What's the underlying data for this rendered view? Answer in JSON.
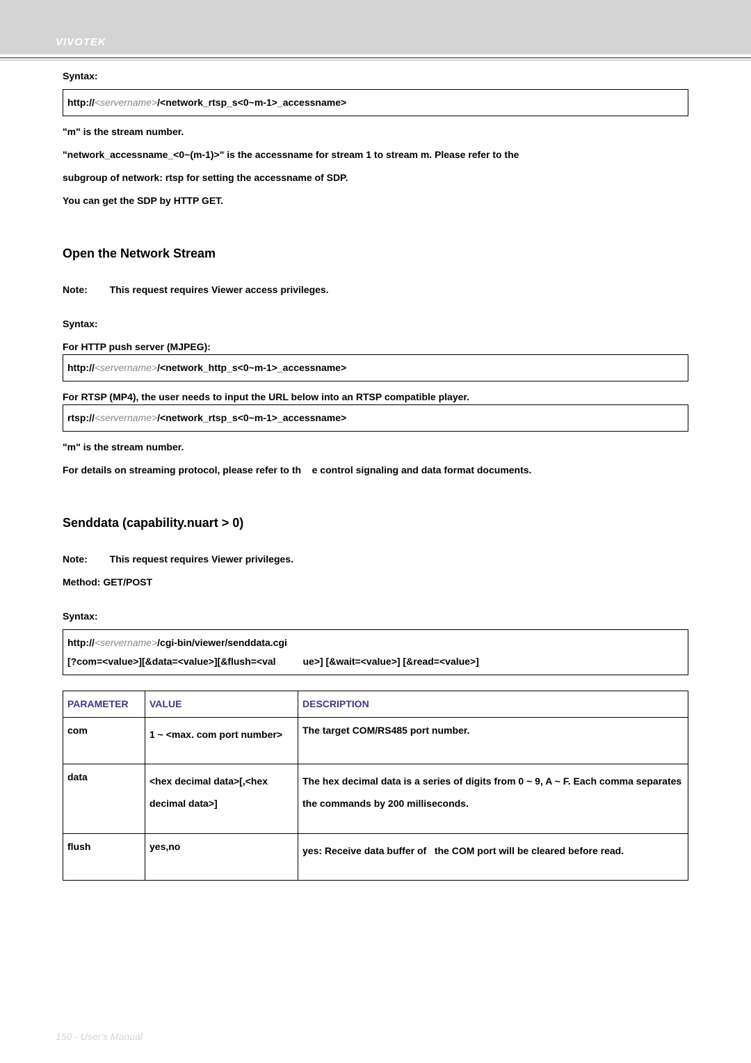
{
  "header": {
    "brand": "VIVOTEK"
  },
  "box1": {
    "syntax_label": "Syntax:",
    "line_prefix": "http://",
    "line_server_gray": "<servername>",
    "line_path_bold": "/<network_rtsp_s<0~m-1>_accessname>"
  },
  "paras1": {
    "p1": "\"m\" is the stream number.",
    "p2": "\"network_accessname_<0~(m-1)>\" is the accessname for stream 1 to stream m. Please refer to the",
    "p3": "subgroup of network: rtsp for setting the accessname of SDP.",
    "p4": "You can get the SDP by HTTP GET."
  },
  "section2": {
    "marker": "Open the Network Stream",
    "note_sym": "Note:",
    "note_text": "This request requires Viewer access privileges.",
    "syntax_label": "Syntax:",
    "mjpeg_label": "For HTTP push server (MJPEG):",
    "mjpeg_prefix": "http://",
    "mjpeg_gray": "<servername>",
    "mjpeg_bold": "/<network_http_s<0~m-1>_accessname>",
    "rtsp_label": "For RTSP (MP4), the user needs to input the URL below into an RTSP compatible player.",
    "rtsp_prefix": "rtsp://",
    "rtsp_gray": "<servername>",
    "rtsp_bold": "/<network_rtsp_s<0~m-1>_accessname>",
    "p1": "\"m\" is the stream number.",
    "p2_a": "For details on streaming protocol, please refer to th",
    "p2_b": "e control signaling and data format documents."
  },
  "section3": {
    "marker": "Senddata (capability.nuart > 0)",
    "note_sym": "Note:",
    "note_text": "This request requires Viewer privileges.",
    "method": "Method: GET/POST",
    "syntax_label": "Syntax:",
    "line_prefix": "http://",
    "line_gray": "<servername>",
    "line_bold": "/cgi-bin/viewer/senddata.cgi",
    "line2_a": "[?com=<value>][&data=<value>][&flush=<val",
    "line2_b": "ue>] [&wait=<value>] [&read=<value>]"
  },
  "table": {
    "headers": [
      "PARAMETER",
      "VALUE",
      "DESCRIPTION"
    ],
    "rows": [
      {
        "param": "com",
        "value": "1 ~ <max. com port number>",
        "desc": "The target COM/RS485 port number."
      },
      {
        "param": "data",
        "value": "<hex decimal data>[,<hex decimal data>]",
        "desc": "The hex decimal data is a series of digits from 0 ~ 9, A ~ F. Each comma separates the commands by 200 milliseconds."
      },
      {
        "param": "flush",
        "value": "yes,no",
        "desc_a": "yes: Receive data buffer of",
        "desc_b": "the COM port will be cleared before read."
      }
    ]
  },
  "footer": "150 - User's Manual"
}
